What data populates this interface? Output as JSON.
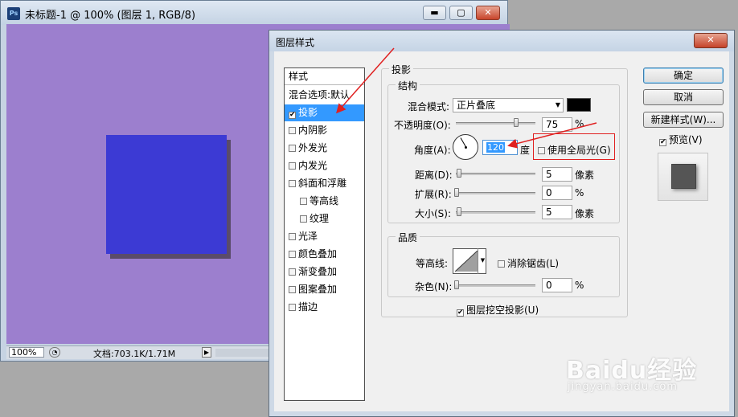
{
  "document": {
    "title": "未标题-1 @ 100% (图层 1, RGB/8)",
    "app_icon": "Ps",
    "minimize_glyph": "▬",
    "maximize_glyph": "▢",
    "close_glyph": "✕",
    "status": {
      "zoom": "100%",
      "doc_info": "文档:703.1K/1.71M"
    },
    "colors": {
      "canvas": "#9c7fce",
      "shape": "#3c3ad4"
    }
  },
  "dialog": {
    "title": "图层样式",
    "close_glyph": "✕",
    "styles_list": {
      "header": "样式",
      "blend_options": "混合选项:默认",
      "items": [
        {
          "label": "投影",
          "checked": "✔",
          "selected": true
        },
        {
          "label": "内阴影",
          "checked": ""
        },
        {
          "label": "外发光",
          "checked": ""
        },
        {
          "label": "内发光",
          "checked": ""
        },
        {
          "label": "斜面和浮雕",
          "checked": ""
        },
        {
          "label": "等高线",
          "checked": ""
        },
        {
          "label": "纹理",
          "checked": ""
        },
        {
          "label": "光泽",
          "checked": ""
        },
        {
          "label": "颜色叠加",
          "checked": ""
        },
        {
          "label": "渐变叠加",
          "checked": ""
        },
        {
          "label": "图案叠加",
          "checked": ""
        },
        {
          "label": "描边",
          "checked": ""
        }
      ]
    },
    "drop_shadow": {
      "section_title": "投影",
      "structure": {
        "title": "结构",
        "blend_mode_label": "混合模式:",
        "blend_mode_value": "正片叠底",
        "shadow_color": "#000000",
        "opacity_label": "不透明度(O):",
        "opacity_value": "75",
        "opacity_unit": "%",
        "angle_label": "角度(A):",
        "angle_value": "120",
        "angle_unit": "度",
        "global_light_label": "使用全局光(G)",
        "global_light_checked": "",
        "distance_label": "距离(D):",
        "distance_value": "5",
        "distance_unit": "像素",
        "spread_label": "扩展(R):",
        "spread_value": "0",
        "spread_unit": "%",
        "size_label": "大小(S):",
        "size_value": "5",
        "size_unit": "像素"
      },
      "quality": {
        "title": "品质",
        "contour_label": "等高线:",
        "antialias_label": "消除锯齿(L)",
        "antialias_checked": "",
        "noise_label": "杂色(N):",
        "noise_value": "0",
        "noise_unit": "%"
      },
      "knockout_label": "图层挖空投影(U)",
      "knockout_checked": "✔"
    },
    "buttons": {
      "ok": "确定",
      "cancel": "取消",
      "new_style": "新建样式(W)...",
      "preview_label": "预览(V)",
      "preview_checked": "✔"
    }
  },
  "watermark": {
    "logo": "Baidu经验",
    "url": "jingyan.baidu.com"
  },
  "annotation_color": "#e02020"
}
